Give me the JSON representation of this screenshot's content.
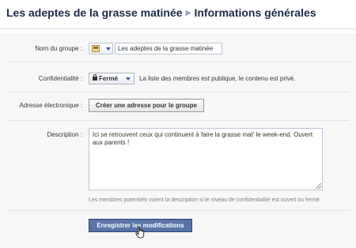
{
  "header": {
    "group_name": "Les adeptes de la grasse matinée",
    "page_title": "Informations générales"
  },
  "form": {
    "name": {
      "label": "Nom du groupe :",
      "value": "Les adeptes de la grasse matinée",
      "icon": "group-people-icon"
    },
    "privacy": {
      "label": "Confidentialité :",
      "selected": "Fermé",
      "icon": "lock-icon",
      "description": "La liste des membres est publique, le contenu est privé."
    },
    "email": {
      "label": "Adresse électronique :",
      "button_label": "Créer une adresse pour le groupe"
    },
    "description": {
      "label": "Description :",
      "value": "Ici se retrouvent ceux qui continuent à faire la grasse mat' le week-end. Ouvert aux parents !",
      "hint": "Les membres potentiels voient la description si le niveau de confidentialité est ouvert ou fermé."
    },
    "submit_label": "Enregistrer les modifications"
  },
  "colors": {
    "brand_dark": "#1c2a47",
    "accent": "#3b5998",
    "submit_bg": "#5b74a8"
  }
}
